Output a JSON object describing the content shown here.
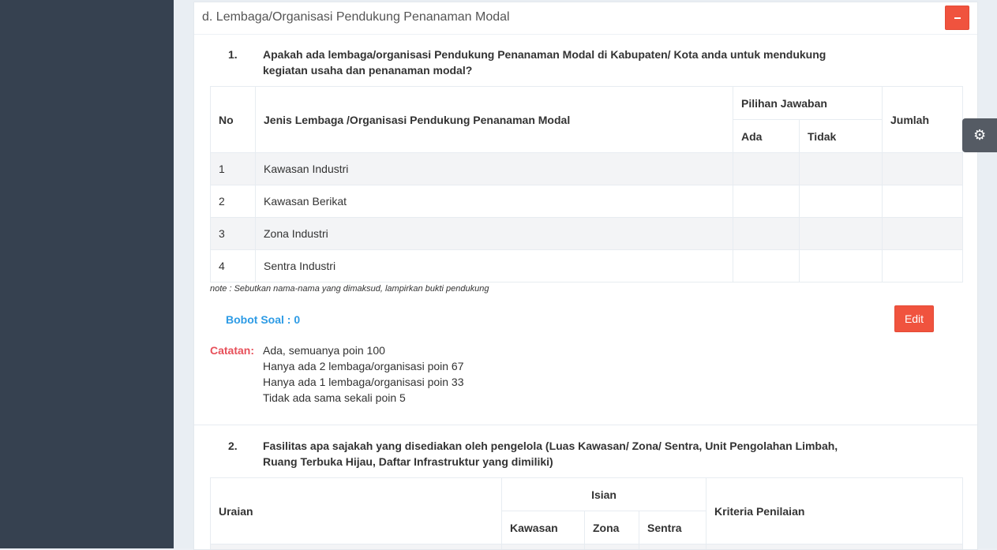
{
  "section": {
    "title": "d. Lembaga/Organisasi Pendukung Penanaman Modal",
    "collapse_label": "-"
  },
  "question1": {
    "number": "1.",
    "text": "Apakah ada lembaga/organisasi Pendukung Penanaman Modal di Kabupaten/ Kota anda untuk mendukung kegiatan usaha dan penanaman modal?",
    "table": {
      "headers": {
        "no": "No",
        "jenis": "Jenis Lembaga /Organisasi Pendukung Penanaman Modal",
        "pilihan": "Pilihan Jawaban",
        "ada": "Ada",
        "tidak": "Tidak",
        "jumlah": "Jumlah"
      },
      "rows": [
        {
          "no": "1",
          "jenis": "Kawasan Industri",
          "ada": "",
          "tidak": "",
          "jumlah": ""
        },
        {
          "no": "2",
          "jenis": "Kawasan Berikat",
          "ada": "",
          "tidak": "",
          "jumlah": ""
        },
        {
          "no": "3",
          "jenis": "Zona Industri",
          "ada": "",
          "tidak": "",
          "jumlah": ""
        },
        {
          "no": "4",
          "jenis": "Sentra Industri",
          "ada": "",
          "tidak": "",
          "jumlah": ""
        }
      ]
    },
    "note": "note : Sebutkan nama-nama yang dimaksud, lampirkan bukti pendukung",
    "bobot": "Bobot Soal : 0",
    "edit_label": "Edit",
    "catatan_label": "Catatan:",
    "catatan": [
      "Ada, semuanya poin 100",
      "Hanya ada 2 lembaga/organisasi poin 67",
      "Hanya ada 1 lembaga/organisasi poin 33",
      "Tidak ada sama sekali poin 5"
    ]
  },
  "question2": {
    "number": "2.",
    "text": "Fasilitas apa sajakah yang disediakan oleh pengelola (Luas Kawasan/ Zona/ Sentra, Unit Pengolahan Limbah, Ruang Terbuka Hijau, Daftar Infrastruktur yang dimiliki)",
    "table": {
      "headers": {
        "uraian": "Uraian",
        "isian": "Isian",
        "kawasan": "Kawasan",
        "zona": "Zona",
        "sentra": "Sentra",
        "kriteria": "Kriteria Penilaian"
      }
    }
  },
  "icons": {
    "gear": "gear-icon",
    "minus": "minus-icon"
  },
  "colors": {
    "sidebar": "#364150",
    "danger": "#f0533e",
    "bobot": "#2d9be5",
    "catatan": "#e7505a",
    "gear_tab": "#555b64"
  }
}
